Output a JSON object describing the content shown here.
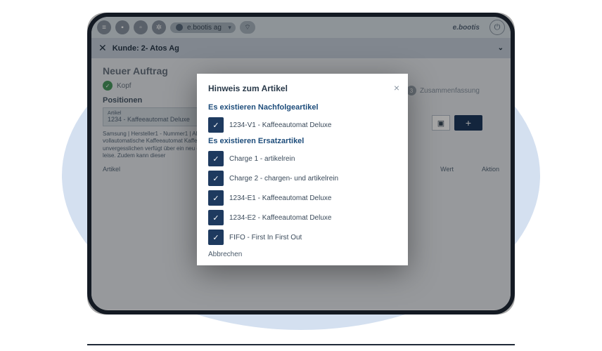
{
  "topbar": {
    "brand": "e.bootis ag",
    "logo": "e.bootis"
  },
  "subbar": {
    "label": "Kunde: 2- Atos Ag"
  },
  "page": {
    "title": "Neuer Auftrag",
    "step1": "Kopf",
    "step3_num": "3",
    "step3": "Zusammenfassung",
    "section": "Positionen",
    "article_lbl": "Artikel",
    "article_val": "1234 - Kaffeeautomat Deluxe",
    "desc": "Samsung | Hersteller1 - Nummer1 | AEG NurDieNummer\nDieser vollautomatische Kaffeeautomat Kaffeegenuss zu einem unvergesslichen verfügt über ein neu entwickeltes Mahl nur 5db sehr leise. Zudem kann dieser",
    "col_article": "Artikel",
    "col_wert": "Wert",
    "col_aktion": "Aktion"
  },
  "modal": {
    "title": "Hinweis zum Artikel",
    "section1": "Es existieren Nachfolgeartikel",
    "items1": [
      "1234-V1 - Kaffeeautomat Deluxe"
    ],
    "section2": "Es existieren Ersatzartikel",
    "items2": [
      "Charge 1 - artikelrein",
      "Charge 2 - chargen- und artikelrein",
      "1234-E1 - Kaffeeautomat Deluxe",
      "1234-E2 - Kaffeeautomat Deluxe",
      "FIFO - First In First Out"
    ],
    "cancel": "Abbrechen"
  }
}
